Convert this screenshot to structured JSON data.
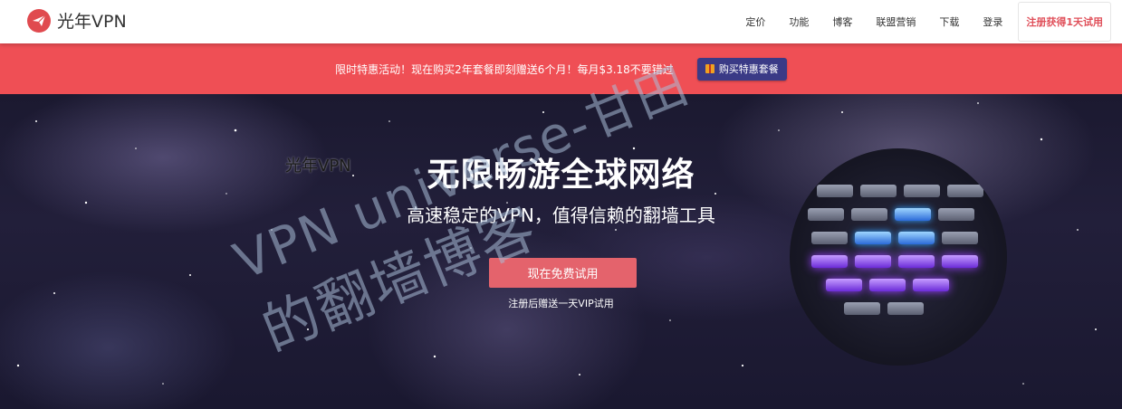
{
  "header": {
    "logo_text": "光年VPN",
    "nav": [
      "定价",
      "功能",
      "博客",
      "联盟营销",
      "下载",
      "登录"
    ],
    "cta_label": "注册获得1天试用"
  },
  "promo": {
    "text": "限时特惠活动！现在购买2年套餐即刻赠送6个月！每月$3.18不要错过",
    "button_label": "购买特惠套餐"
  },
  "hero": {
    "brand_overlay": "光年VPN",
    "title": "无限畅游全球网络",
    "subtitle": "高速稳定的VPN，值得信赖的翻墙工具",
    "button_label": "现在免费试用",
    "note": "注册后赠送一天VIP试用"
  },
  "watermark": {
    "line1": "VPN universe-甘田",
    "line2": "的翻墙博客"
  },
  "colors": {
    "accent": "#ef4f55",
    "promo_button": "#3a3a86",
    "hero_button": "#e4636c",
    "cta_text": "#e0505a"
  },
  "icons": {
    "logo": "paper-plane-icon",
    "promo_button": "gift-icon"
  }
}
